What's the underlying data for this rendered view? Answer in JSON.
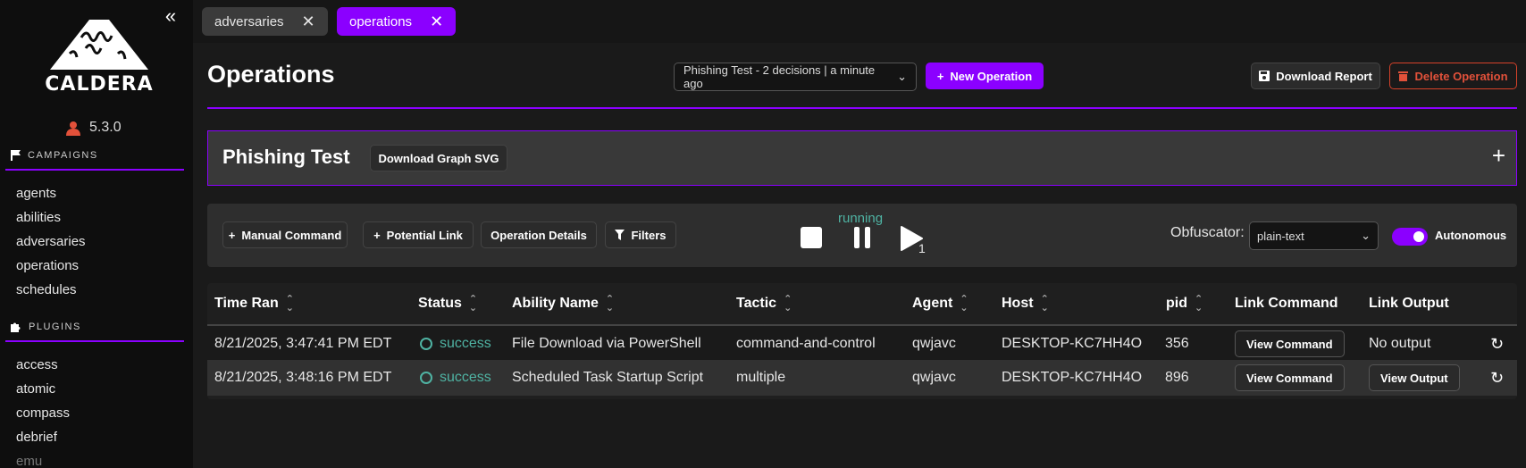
{
  "sidebar": {
    "logo_text": "CALDERA",
    "version": "5.3.0",
    "campaigns_heading": "CAMPAIGNS",
    "campaign_items": [
      "agents",
      "abilities",
      "adversaries",
      "operations",
      "schedules"
    ],
    "plugins_heading": "PLUGINS",
    "plugin_items": [
      "access",
      "atomic",
      "compass",
      "debrief",
      "emu"
    ]
  },
  "tabs": [
    {
      "label": "adversaries",
      "active": false
    },
    {
      "label": "operations",
      "active": true
    }
  ],
  "header": {
    "title": "Operations",
    "operation_select": "Phishing Test - 2 decisions | a minute ago",
    "new_operation": "New Operation",
    "download_report": "Download Report",
    "delete_operation": "Delete Operation"
  },
  "graph": {
    "title": "Phishing Test",
    "download_svg": "Download Graph SVG"
  },
  "controls": {
    "manual_command": "Manual Command",
    "potential_link": "Potential Link",
    "operation_details": "Operation Details",
    "filters": "Filters",
    "state": "running",
    "play_count": "1",
    "obfuscator_label": "Obfuscator:",
    "obfuscator_value": "plain-text",
    "autonomous_label": "Autonomous",
    "autonomous_on": true
  },
  "table": {
    "headers": [
      "Time Ran",
      "Status",
      "Ability Name",
      "Tactic",
      "Agent",
      "Host",
      "pid",
      "Link Command",
      "Link Output"
    ],
    "rows": [
      {
        "time": "8/21/2025, 3:47:41 PM EDT",
        "status": "success",
        "ability": "File Download via PowerShell",
        "tactic": "command-and-control",
        "agent": "qwjavc",
        "host": "DESKTOP-KC7HH4O",
        "pid": "356",
        "command": "View Command",
        "output": "No output"
      },
      {
        "time": "8/21/2025, 3:48:16 PM EDT",
        "status": "success",
        "ability": "Scheduled Task Startup Script",
        "tactic": "multiple",
        "agent": "qwjavc",
        "host": "DESKTOP-KC7HH4O",
        "pid": "896",
        "command": "View Command",
        "output": "View Output"
      }
    ]
  },
  "colors": {
    "accent": "#8b00ff",
    "success": "#4fb3a3",
    "danger": "#e2513a"
  }
}
